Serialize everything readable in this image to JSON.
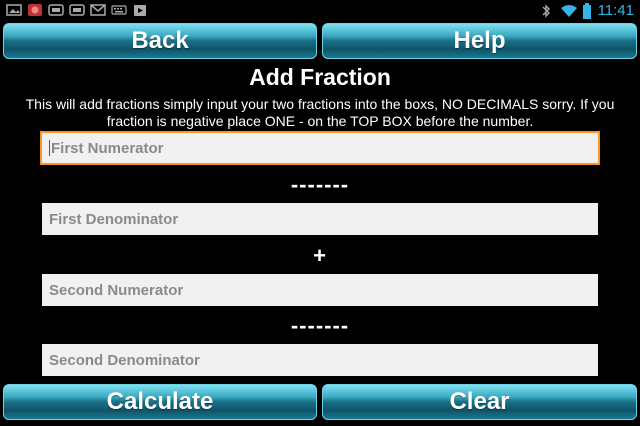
{
  "status_bar": {
    "time": "11:41",
    "left_icons": [
      "picture-icon",
      "app-icon",
      "storage-icon",
      "storage-icon",
      "gmail-icon",
      "keyboard-icon",
      "play-store-icon"
    ],
    "right_icons": [
      "bluetooth-icon",
      "wifi-icon",
      "battery-icon"
    ],
    "accent_color": "#33b5e5"
  },
  "buttons": {
    "back": "Back",
    "help": "Help",
    "calculate": "Calculate",
    "clear": "Clear"
  },
  "screen": {
    "title": "Add Fraction",
    "description": "This will add fractions simply input your two fractions into the boxs, NO DECIMALS sorry. If you fraction is negative place ONE - on the TOP BOX before  the number."
  },
  "fields": {
    "first_numerator": {
      "placeholder": "First Numerator",
      "value": ""
    },
    "first_denominator": {
      "placeholder": "First Denominator",
      "value": ""
    },
    "second_numerator": {
      "placeholder": "Second Numerator",
      "value": ""
    },
    "second_denominator": {
      "placeholder": "Second Denominator",
      "value": ""
    }
  },
  "separators": {
    "fraction_bar_1": "-------",
    "operator": "+",
    "fraction_bar_2": "-------"
  },
  "colors": {
    "focus_border": "#f59a1f",
    "field_bg": "#f1f1f1",
    "button_gradient_mid": "#1a6f86"
  }
}
